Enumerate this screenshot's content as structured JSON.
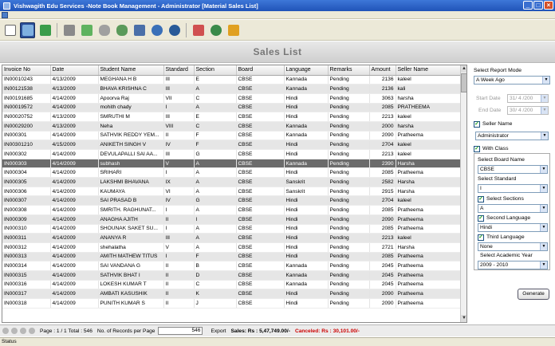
{
  "window": {
    "title": "Vishwagith Edu Services  -Note Book Management - Administrator  [Material Sales List]",
    "controls": [
      "minimize",
      "maximize",
      "close"
    ]
  },
  "header": {
    "title": "Sales List"
  },
  "table": {
    "columns": [
      "Invoice No",
      "Date",
      "Student Name",
      "Standard",
      "Section",
      "Board",
      "Language",
      "Remarks",
      "Amount",
      "Seller Name"
    ],
    "rows": [
      [
        "IN00010243",
        "4/13/2009",
        "MEGHANA H B",
        "III",
        "E",
        "CBSE",
        "Kannada",
        "Pending",
        "2136",
        "kaleel"
      ],
      [
        "IN00121538",
        "4/13/2009",
        "BHAVA KRISHNA C",
        "III",
        "A",
        "CBSE",
        "Kannada",
        "Pending",
        "2136",
        "kali"
      ],
      [
        "IN00191685",
        "4/14/2009",
        "Apoorva Raj",
        "VII",
        "C",
        "CBSE",
        "Hindi",
        "Pending",
        "3063",
        "harsha"
      ],
      [
        "IN00019572",
        "4/14/2009",
        "mohith chady",
        "I",
        "A",
        "CBSE",
        "Hindi",
        "Pending",
        "2085",
        "PRATHEEMA"
      ],
      [
        "IN00020752",
        "4/13/2009",
        "SMRUTHI M",
        "III",
        "E",
        "CBSE",
        "Hindi",
        "Pending",
        "2213",
        "kaleel"
      ],
      [
        "IN00029200",
        "4/13/2009",
        "Neha",
        "VIII",
        "C",
        "CBSE",
        "Kannada",
        "Pending",
        "2000",
        "harsha"
      ],
      [
        "IN000301",
        "4/14/2009",
        "SATHVIK REDDY YEM...",
        "II",
        "F",
        "CBSE",
        "Kannada",
        "Pending",
        "2090",
        "Pratheema"
      ],
      [
        "IN00301210",
        "4/15/2009",
        "ANIKETH SINGH V",
        "IV",
        "F",
        "CBSE",
        "Hindi",
        "Pending",
        "2704",
        "kaleel"
      ],
      [
        "IN000302",
        "4/14/2009",
        "DEVULAPALLI SAI AA...",
        "III",
        "G",
        "CBSE",
        "Hindi",
        "Pending",
        "2213",
        "kaleel"
      ],
      [
        "IN000303",
        "4/14/2009",
        "subhash",
        "V",
        "A",
        "CBSE",
        "Kannada",
        "Pending",
        "2390",
        "Harsha"
      ],
      [
        "IN000304",
        "4/14/2009",
        "SRIHARI",
        "I",
        "A",
        "CBSE",
        "Hindi",
        "Pending",
        "2085",
        "Pratheema"
      ],
      [
        "IN000305",
        "4/14/2009",
        "LAKSHMI BHAVANA",
        "IX",
        "A",
        "CBSE",
        "Sanskrit",
        "Pending",
        "2582",
        "Harsha"
      ],
      [
        "IN000306",
        "4/14/2009",
        "KAUMAYA",
        "VI",
        "A",
        "CBSE",
        "Sanskrit",
        "Pending",
        "2915",
        "Harsha"
      ],
      [
        "IN000307",
        "4/14/2009",
        "SAI PRASAD B",
        "IV",
        "G",
        "CBSE",
        "Hindi",
        "Pending",
        "2704",
        "kaleel"
      ],
      [
        "IN000308",
        "4/14/2009",
        "SMRITH. RAGHUNAT...",
        "I",
        "A",
        "CBSE",
        "Hindi",
        "Pending",
        "2085",
        "Pratheema"
      ],
      [
        "IN000309",
        "4/14/2009",
        "ANAGHA AJITH",
        "II",
        "I",
        "CBSE",
        "Hindi",
        "Pending",
        "2090",
        "Pratheema"
      ],
      [
        "IN000310",
        "4/14/2009",
        "SHOUNAK SAKET SU...",
        "I",
        "A",
        "CBSE",
        "Hindi",
        "Pending",
        "2085",
        "Pratheema"
      ],
      [
        "IN000311",
        "4/14/2009",
        "ANANYA R",
        "III",
        "A",
        "CBSE",
        "Hindi",
        "Pending",
        "2213",
        "kaleel"
      ],
      [
        "IN000312",
        "4/14/2009",
        "shehalatha",
        "V",
        "A",
        "CBSE",
        "Hindi",
        "Pending",
        "2721",
        "Harsha"
      ],
      [
        "IN000313",
        "4/14/2009",
        "AMITH MATHEW TITUS",
        "I",
        "F",
        "CBSE",
        "Hindi",
        "Pending",
        "2085",
        "Pratheema"
      ],
      [
        "IN000314",
        "4/14/2009",
        "SAI VANDANA G",
        "II",
        "B",
        "CBSE",
        "Kannada",
        "Pending",
        "2045",
        "Pratheema"
      ],
      [
        "IN000315",
        "4/14/2009",
        "SATHVIK BHAT I",
        "II",
        "D",
        "CBSE",
        "Kannada",
        "Pending",
        "2045",
        "Pratheema"
      ],
      [
        "IN000316",
        "4/14/2009",
        "LOKESH KUMAR T",
        "II",
        "C",
        "CBSE",
        "Kannada",
        "Pending",
        "2045",
        "Pratheema"
      ],
      [
        "IN000317",
        "4/14/2009",
        "AMBATI KASUSHIK",
        "II",
        "K",
        "CBSE",
        "Hindi",
        "Pending",
        "2090",
        "Pratheema"
      ],
      [
        "IN000318",
        "4/14/2009",
        "PUNITH KUMAR S",
        "II",
        "J",
        "CBSE",
        "Hindi",
        "Pending",
        "2090",
        "Pratheema"
      ]
    ],
    "selected_row": 9
  },
  "sidepanel": {
    "report_mode_label": "Select Report Mode",
    "report_mode_value": "A Week Ago",
    "start_date_label": "Start Date",
    "start_date_value": "31/ 4 /200",
    "end_date_label": "End Date",
    "end_date_value": "30/ 4 /200",
    "seller_name_label": "Seller Name",
    "seller_name_value": "Administrator",
    "with_class_label": "With Class",
    "board_label": "Select Board Name",
    "board_value": "CBSE",
    "standard_label": "Select Standard",
    "standard_value": "I",
    "sections_label": "Select Sections",
    "sections_value": "A",
    "second_lang_label": "Second Language",
    "second_lang_value": "Hindi",
    "third_lang_label": "Third Language",
    "third_lang_value": "None",
    "academic_year_label": "Select Academic Year",
    "academic_year_value": "2009 - 2010",
    "generate_label": "Generate"
  },
  "footer": {
    "page_info": "Page : 1 / 1 Total : 546",
    "records_label": "No. of Records per Page",
    "records_value": "546",
    "export_label": "Export",
    "sales_text": "Sales: Rs : 5,47,749.00/-",
    "cancelled_text": "Canceled: Rs : 30,101.00/-"
  },
  "statusbar": {
    "text": "Status"
  },
  "colors": {
    "title_bar": "#2053b8",
    "selected_row": "#6b6b6b",
    "alt_row": "#e6e6e6",
    "cancel_text": "#cc0000"
  }
}
